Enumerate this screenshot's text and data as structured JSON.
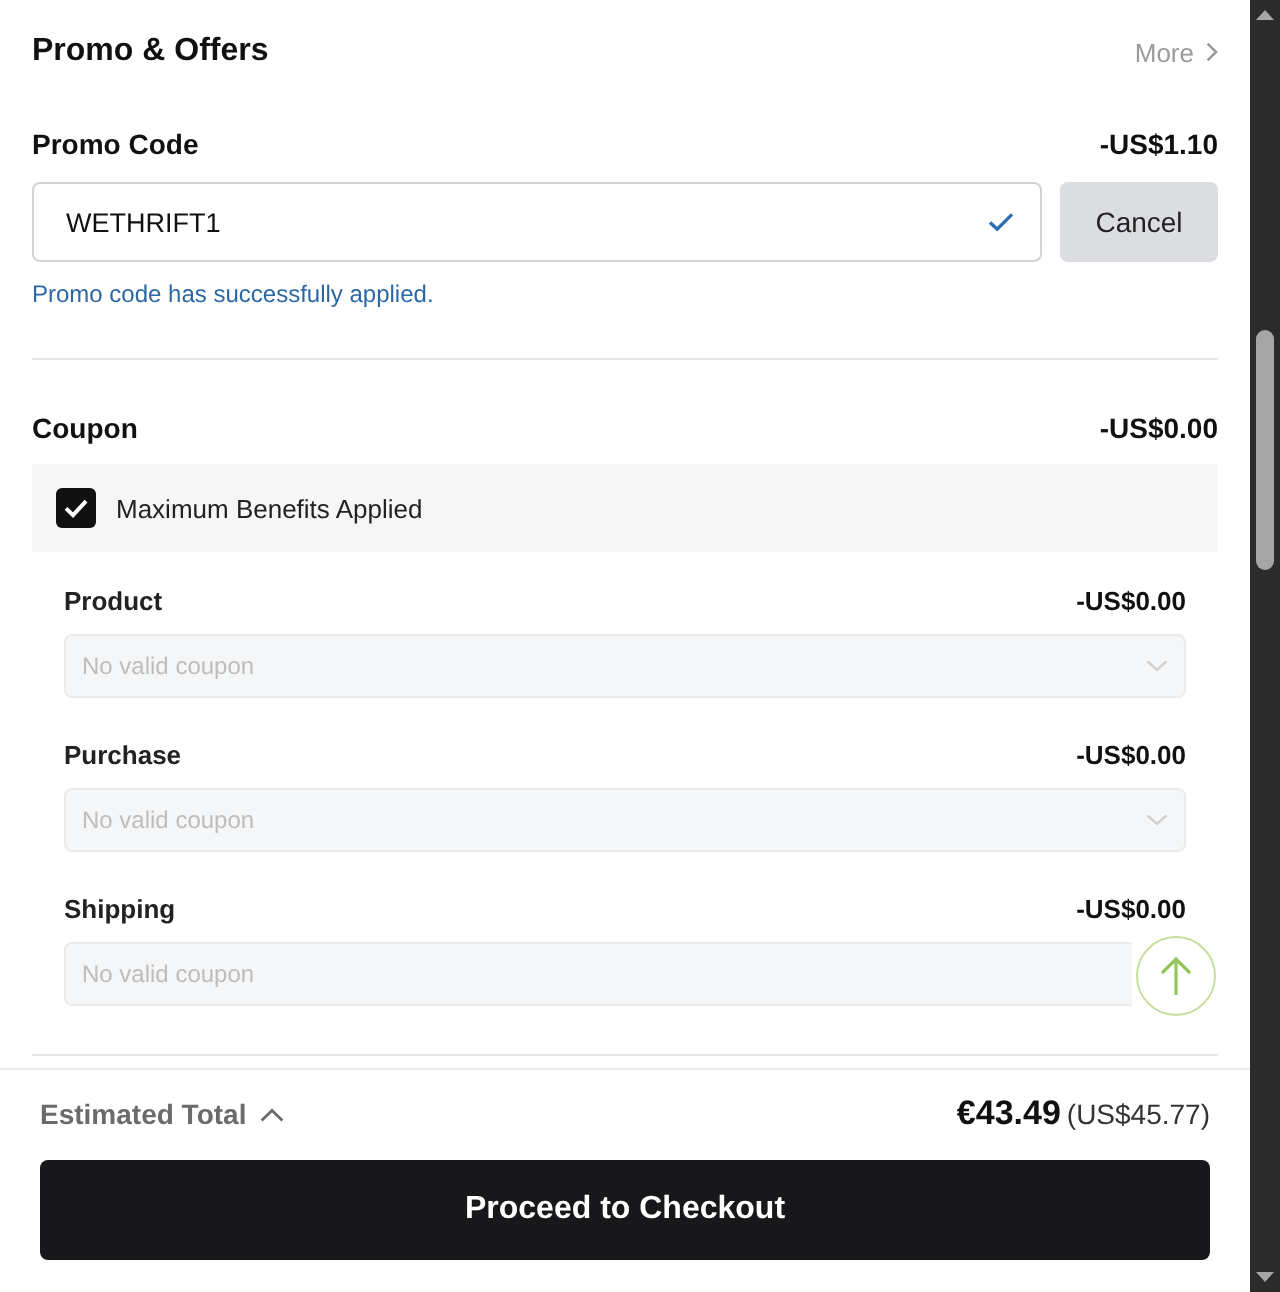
{
  "header": {
    "title": "Promo & Offers",
    "more_link": "More"
  },
  "promo_code": {
    "label": "Promo Code",
    "discount": "-US$1.10",
    "value": "WETHRIFT1",
    "valid": true,
    "cancel_button": "Cancel",
    "message": "Promo code has successfully applied."
  },
  "coupon": {
    "label": "Coupon",
    "discount": "-US$0.00",
    "max_benefits": {
      "label": "Maximum Benefits Applied",
      "checked": true
    },
    "items": [
      {
        "label": "Product",
        "discount": "-US$0.00",
        "placeholder": "No valid coupon",
        "disabled": true
      },
      {
        "label": "Purchase",
        "discount": "-US$0.00",
        "placeholder": "No valid coupon",
        "disabled": true
      },
      {
        "label": "Shipping",
        "discount": "-US$0.00",
        "placeholder": "No valid coupon",
        "disabled": true
      }
    ]
  },
  "footer": {
    "total_label": "Estimated Total",
    "total": "€43.49",
    "total_converted": "(US$45.77)",
    "checkout_button": "Proceed to Checkout"
  }
}
